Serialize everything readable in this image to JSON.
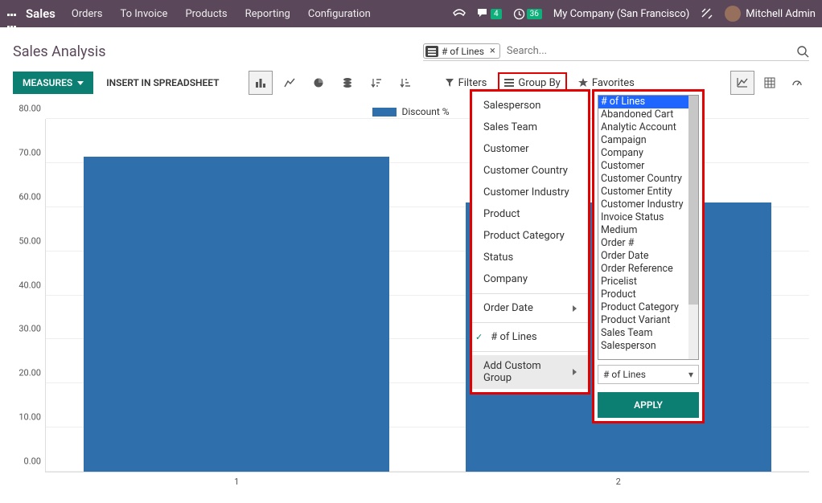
{
  "nav": {
    "brand": "Sales",
    "items": [
      "Orders",
      "To Invoice",
      "Products",
      "Reporting",
      "Configuration"
    ],
    "msg_badge": "4",
    "clock_badge": "36",
    "company": "My Company (San Francisco)",
    "user": "Mitchell Admin"
  },
  "page": {
    "title": "Sales Analysis"
  },
  "search": {
    "chip_label": "# of Lines",
    "placeholder": "Search..."
  },
  "toolbar": {
    "measures": "MEASURES",
    "insert": "INSERT IN SPREADSHEET",
    "filters": "Filters",
    "groupby": "Group By",
    "favorites": "Favorites"
  },
  "chart_data": {
    "type": "bar",
    "title": "",
    "legend": "Discount %",
    "categories": [
      "1",
      "2"
    ],
    "values": [
      71.5,
      61.0
    ],
    "ylim": [
      0,
      80
    ],
    "yticks": [
      0.0,
      10.0,
      20.0,
      30.0,
      40.0,
      50.0,
      60.0,
      70.0,
      80.0
    ],
    "ytick_labels": [
      "0.00",
      "10.00",
      "20.00",
      "30.00",
      "40.00",
      "50.00",
      "60.00",
      "70.00",
      "80.00"
    ]
  },
  "groupby_menu": {
    "items": [
      "Salesperson",
      "Sales Team",
      "Customer",
      "Customer Country",
      "Customer Industry",
      "Product",
      "Product Category",
      "Status",
      "Company"
    ],
    "date_item": "Order Date",
    "checked_item": "# of Lines",
    "add_custom": "Add Custom Group"
  },
  "custom_group": {
    "options": [
      "# of Lines",
      "Abandoned Cart",
      "Analytic Account",
      "Campaign",
      "Company",
      "Customer",
      "Customer Country",
      "Customer Entity",
      "Customer Industry",
      "Invoice Status",
      "Medium",
      "Order #",
      "Order Date",
      "Order Reference",
      "Pricelist",
      "Product",
      "Product Category",
      "Product Variant",
      "Sales Team",
      "Salesperson"
    ],
    "selected": "# of Lines",
    "apply": "APPLY"
  }
}
